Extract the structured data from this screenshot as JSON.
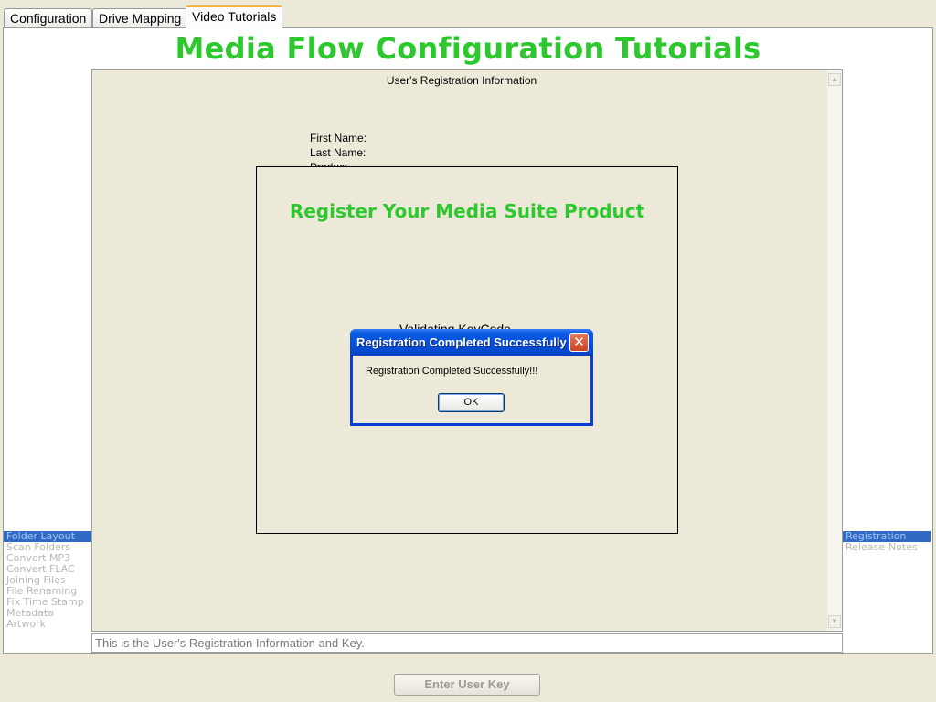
{
  "tabs": [
    {
      "label": "Configuration"
    },
    {
      "label": "Drive Mapping"
    },
    {
      "label": "Video Tutorials"
    }
  ],
  "header": {
    "title": "Media Flow Configuration Tutorials"
  },
  "content": {
    "heading": "User's Registration Information",
    "fields": {
      "first_name": "First Name:",
      "last_name": "Last  Name:",
      "product": "Product"
    },
    "scroll_up_icon": "up-arrow",
    "scroll_down_icon": "down-arrow"
  },
  "registration_panel": {
    "title": "Register Your Media Suite Product",
    "validating_text": "Validating KeyCode"
  },
  "dialog": {
    "title": "Registration Completed Successfully",
    "message": "Registration Completed Successfully!!!",
    "ok_label": "OK",
    "close_icon": "✕"
  },
  "left_list": {
    "items": [
      "Folder Layout",
      "Scan Folders",
      "Convert MP3",
      "Convert FLAC",
      "Joining Files",
      "File Renaming",
      "Fix Time Stamp",
      "Metadata",
      "Artwork"
    ],
    "selected": "Folder Layout"
  },
  "right_list": {
    "items": [
      "Registration",
      "Release-Notes"
    ],
    "selected": "Registration"
  },
  "status": {
    "text": "This is the User's Registration Information and Key."
  },
  "footer": {
    "enter_key_label": "Enter User Key"
  },
  "colors": {
    "title_green": "#2dc82d",
    "xp_blue": "#0650d8",
    "selection_blue": "#316ac5",
    "background": "#ece9d8"
  }
}
